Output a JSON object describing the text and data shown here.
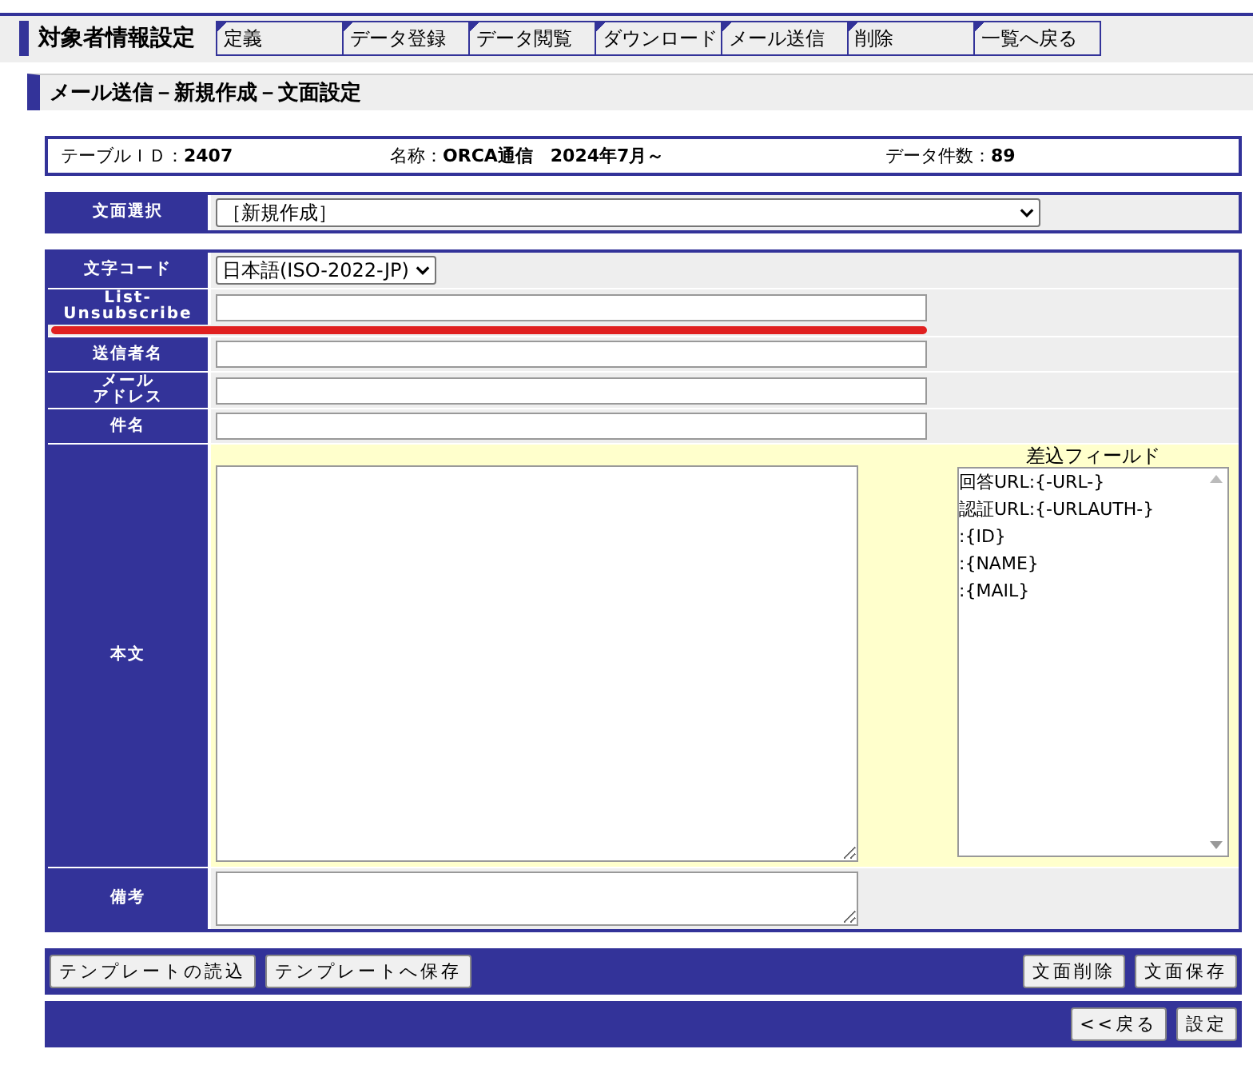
{
  "header": {
    "title": "対象者情報設定",
    "tabs": [
      {
        "label": "定義"
      },
      {
        "label": "データ登録"
      },
      {
        "label": "データ閲覧"
      },
      {
        "label": "ダウンロード"
      },
      {
        "label": "メール送信"
      },
      {
        "label": "削除"
      },
      {
        "label": "一覧へ戻る"
      }
    ]
  },
  "section_title": "メール送信－新規作成－文面設定",
  "info": [
    {
      "label": "テーブルＩＤ：",
      "value": "2407"
    },
    {
      "label": "名称：",
      "value": "ORCA通信　2024年7月～"
    },
    {
      "label": "データ件数：",
      "value": "89"
    }
  ],
  "template_select": {
    "label": "文面選択",
    "value": "［新規作成］"
  },
  "rows": [
    {
      "label": [
        "文字コード"
      ],
      "kind": "select",
      "value": "日本語(ISO-2022-JP)"
    },
    {
      "label": [
        "List-",
        "Unsubscribe"
      ],
      "kind": "input",
      "annotation": {
        "kind": "underline",
        "color": "#e02020"
      }
    },
    {
      "label": [
        "送信者名"
      ],
      "kind": "input"
    },
    {
      "label": [
        "メール",
        "アドレス"
      ],
      "kind": "input"
    },
    {
      "label": [
        "件名"
      ],
      "kind": "input"
    },
    {
      "label": [
        "本文"
      ],
      "kind": "body",
      "merge_fields": {
        "title": "差込フィールド",
        "items": [
          "回答URL:{-URL-}",
          "認証URL:{-URLAUTH-}",
          ":{ID}",
          ":{NAME}",
          ":{MAIL}"
        ]
      }
    },
    {
      "label": [
        "備考"
      ],
      "kind": "textarea"
    }
  ],
  "buttons_left": [
    "テンプレートの読込",
    "テンプレートへ保存"
  ],
  "buttons_right": [
    "文面削除",
    "文面保存"
  ],
  "nav_buttons": [
    "<<戻る",
    "設定"
  ]
}
